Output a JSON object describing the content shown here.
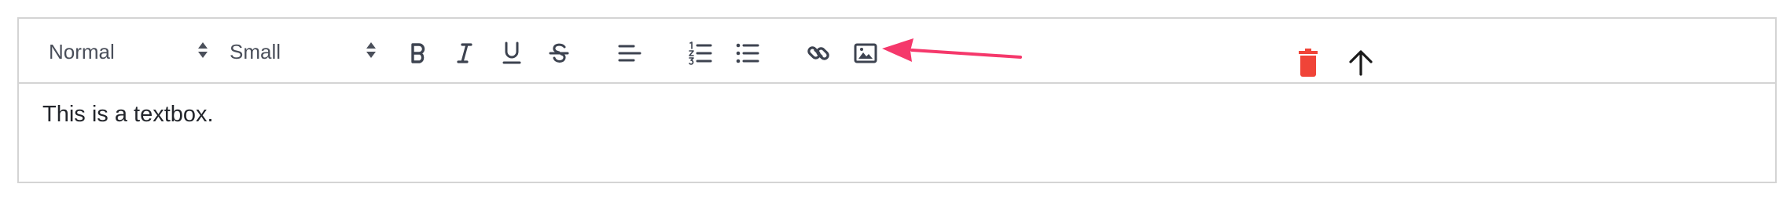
{
  "toolbar": {
    "font_picker": {
      "value": "Normal",
      "icon": "sort-arrows-icon"
    },
    "size_picker": {
      "value": "Small",
      "icon": "sort-arrows-icon"
    },
    "buttons": [
      {
        "name": "bold-button",
        "icon": "bold-icon"
      },
      {
        "name": "italic-button",
        "icon": "italic-icon"
      },
      {
        "name": "underline-button",
        "icon": "underline-icon"
      },
      {
        "name": "strike-button",
        "icon": "strikethrough-icon"
      },
      {
        "name": "align-button",
        "icon": "align-left-icon"
      },
      {
        "name": "ordered-list-button",
        "icon": "ordered-list-icon"
      },
      {
        "name": "bullet-list-button",
        "icon": "bullet-list-icon"
      },
      {
        "name": "link-button",
        "icon": "link-icon"
      },
      {
        "name": "image-button",
        "icon": "image-icon"
      }
    ],
    "actions": [
      {
        "name": "delete-button",
        "icon": "trash-icon",
        "color": "#f04438"
      },
      {
        "name": "move-up-button",
        "icon": "arrow-up-icon",
        "color": "#1a1a1a"
      }
    ]
  },
  "editor": {
    "text": "This is a textbox."
  },
  "annotation": {
    "icon": "pointer-arrow-icon",
    "color": "#f5386b"
  },
  "colors": {
    "icon": "#3d4350",
    "border": "#d4d4d4",
    "text": "#22252b"
  }
}
